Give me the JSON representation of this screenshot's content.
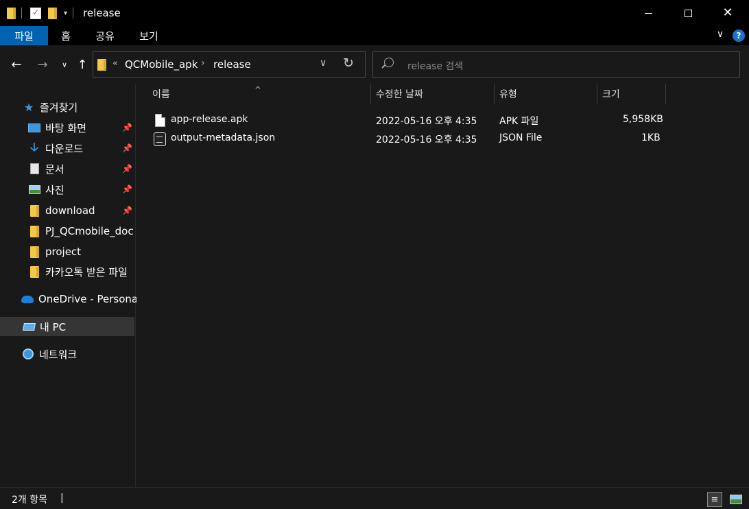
{
  "titlebar": {
    "title": "release",
    "qa_dropdown": "▾",
    "min_label": "",
    "max_label": "",
    "close_label": "✕"
  },
  "ribbon": {
    "tabs": [
      {
        "label": "파일"
      },
      {
        "label": "홈"
      },
      {
        "label": "공유"
      },
      {
        "label": "보기"
      }
    ],
    "help_label": "?",
    "accent_color": "#0063b1"
  },
  "nav": {
    "back": "←",
    "forward": "→",
    "recent": "∨",
    "up": "↑",
    "address": {
      "overflow": "«",
      "segments": [
        "QCMobile_apk",
        "release"
      ],
      "separator": "›",
      "dropdown": "∨",
      "refresh": "↻"
    },
    "search": {
      "placeholder": "release 검색"
    }
  },
  "sidebar": {
    "quick_access": "즐겨찾기",
    "pinned": [
      {
        "label": "바탕 화면",
        "icon": "desktop-icon",
        "pinned": true
      },
      {
        "label": "다운로드",
        "icon": "download-icon",
        "pinned": true
      },
      {
        "label": "문서",
        "icon": "document-icon",
        "pinned": true
      },
      {
        "label": "사진",
        "icon": "pictures-icon",
        "pinned": true
      },
      {
        "label": "download",
        "icon": "folder-icon",
        "pinned": true
      }
    ],
    "folders": [
      {
        "label": "PJ_QCmobile_doc",
        "icon": "folder-icon"
      },
      {
        "label": "project",
        "icon": "folder-icon"
      },
      {
        "label": "카카오톡 받은 파일",
        "icon": "folder-icon"
      }
    ],
    "onedrive": "OneDrive - Personal",
    "this_pc": "내 PC",
    "network": "네트워크",
    "pin_glyph": "📌"
  },
  "content": {
    "columns": {
      "name": "이름",
      "modified": "수정한 날짜",
      "type": "유형",
      "size": "크기"
    },
    "sort_arrow": "^",
    "files": [
      {
        "name": "app-release.apk",
        "modified": "2022-05-16 오후 4:35",
        "type": "APK 파일",
        "size": "5,958KB",
        "icon": "file-icon"
      },
      {
        "name": "output-metadata.json",
        "modified": "2022-05-16 오후 4:35",
        "type": "JSON File",
        "size": "1KB",
        "icon": "json-file-icon"
      }
    ]
  },
  "status": {
    "count": "2개 항목",
    "separator": "|"
  }
}
